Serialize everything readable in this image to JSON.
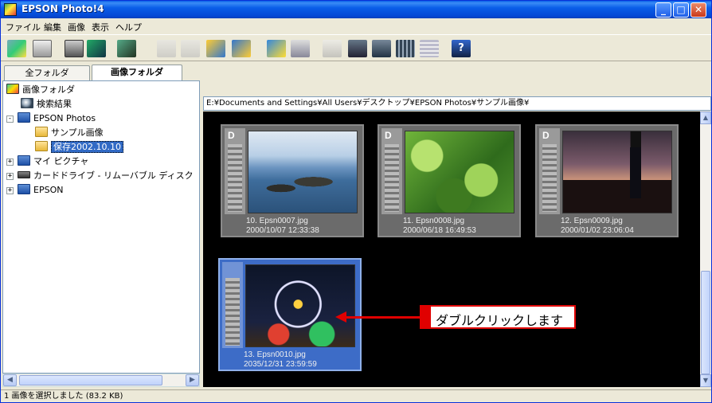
{
  "window": {
    "title": "EPSON Photo!4"
  },
  "menu": [
    "ファイル",
    "編集",
    "画像",
    "表示",
    "ヘルプ"
  ],
  "toolbar": {
    "icons": [
      "folder-new-icon",
      "properties-icon",
      "print-icon",
      "save-icon",
      "album-icon",
      "rotate-left-icon",
      "rotate-right-icon",
      "import-icon",
      "export-icon",
      "view-photo-icon",
      "view-detail-icon",
      "tree-icon",
      "thumb-large-icon",
      "thumb-medium-icon",
      "thumb-small-icon",
      "list-icon",
      "help-icon"
    ]
  },
  "left_panel": {
    "tabs": {
      "all": "全フォルダ",
      "image": "画像フォルダ"
    },
    "tree": [
      {
        "label": "画像フォルダ",
        "icon": "root-folder-icon"
      },
      {
        "label": "検索結果",
        "icon": "search-results-icon"
      },
      {
        "label": "EPSON Photos",
        "icon": "folder-icon"
      },
      {
        "label": "サンプル画像",
        "icon": "folder-icon"
      },
      {
        "label": "保存2002.10.10",
        "icon": "folder-icon",
        "selected": true
      },
      {
        "label": "マイ ピクチャ",
        "icon": "folder-icon"
      },
      {
        "label": "カードドライブ - リムーバブル ディスク",
        "icon": "drive-icon"
      },
      {
        "label": "EPSON",
        "icon": "folder-icon"
      }
    ]
  },
  "path": "E:¥Documents and Settings¥All Users¥デスクトップ¥EPSON Photos¥サンプル画像¥",
  "thumbnails": [
    {
      "badge": "D",
      "name": "10. Epsn0007.jpg",
      "date": "2000/10/07  12:33:38",
      "selected": false
    },
    {
      "badge": "D",
      "name": "11. Epsn0008.jpg",
      "date": "2000/06/18  16:49:53",
      "selected": false
    },
    {
      "badge": "D",
      "name": "12. Epsn0009.jpg",
      "date": "2000/01/02  23:06:04",
      "selected": false
    },
    {
      "badge": "",
      "name": "13. Epsn0010.jpg",
      "date": "2035/12/31  23:59:59",
      "selected": true
    }
  ],
  "callout": {
    "text": "ダブルクリックします",
    "color": "#e00000"
  },
  "status": {
    "text": "1 画像を選択しました  (83.2 KB)"
  },
  "colors": {
    "selection": "#316ac5",
    "titlebar": "#0a5ee8",
    "content_bg": "#000000"
  }
}
